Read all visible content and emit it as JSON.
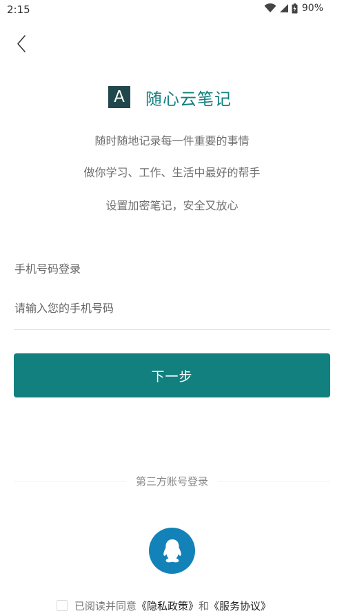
{
  "status_bar": {
    "time": "2:15",
    "battery": "90%"
  },
  "brand": {
    "logo_letter": "A",
    "name": "随心云笔记"
  },
  "taglines": [
    "随时随地记录每一件重要的事情",
    "做你学习、工作、生活中最好的帮手",
    "设置加密笔记，安全又放心"
  ],
  "login": {
    "title": "手机号码登录",
    "phone_placeholder": "请输入您的手机号码",
    "next_label": "下一步"
  },
  "third_party": {
    "label": "第三方账号登录",
    "qq_icon": "qq-penguin-icon"
  },
  "agreement": {
    "text": "已阅读并同意",
    "privacy_link": "《隐私政策》",
    "and": "和",
    "service_link": "《服务协议》"
  },
  "colors": {
    "accent": "#12807f",
    "logo_bg": "#20484c",
    "qq_blue": "#1282b9"
  }
}
